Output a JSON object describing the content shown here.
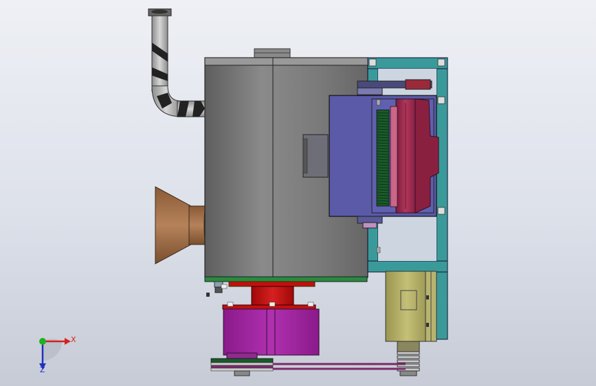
{
  "view": {
    "background_top": "#eef0f5",
    "background_bottom": "#c7cbd6"
  },
  "triad": {
    "x_label": "X",
    "z_label": "Z",
    "x_color": "#d62020",
    "y_color": "#20b020",
    "z_color": "#2030c0"
  },
  "parts": {
    "main_housing": {
      "color": "#7a7a7a"
    },
    "exhaust_pipe": {
      "color": "#b5b5b5"
    },
    "intake_cone": {
      "color": "#a0704a"
    },
    "side_panel": {
      "color": "#5a5aa8"
    },
    "rotor_fins": {
      "color": "#b03050"
    },
    "frame": {
      "color": "#3a9a9a"
    },
    "motor": {
      "color": "#b0ac60"
    },
    "base_plate": {
      "color": "#2a8a3a"
    },
    "coupling": {
      "color": "#c01010"
    },
    "pump_housing": {
      "color": "#a020a0"
    },
    "belt": {
      "color": "#7a2a6a"
    }
  }
}
